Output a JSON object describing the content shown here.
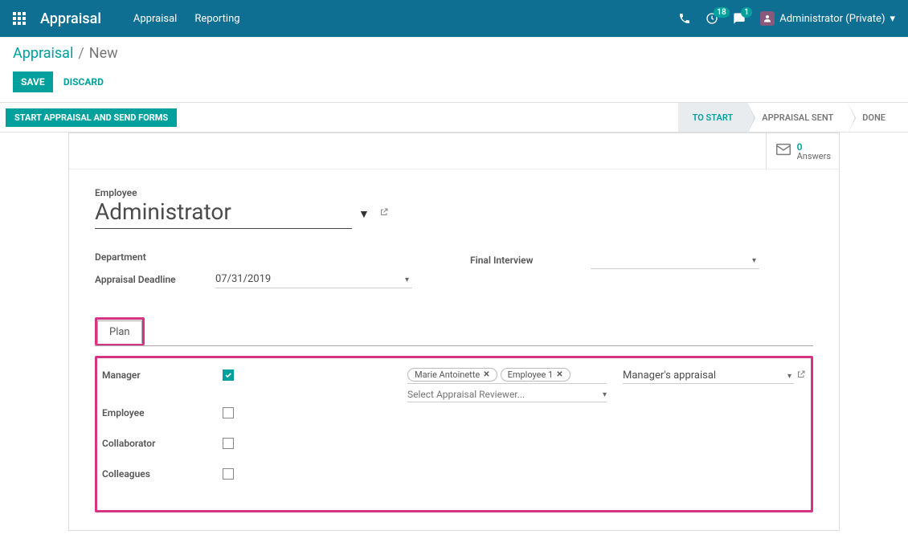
{
  "topnav": {
    "app_title": "Appraisal",
    "links": {
      "appraisal": "Appraisal",
      "reporting": "Reporting"
    },
    "badges": {
      "activity": "18",
      "messages": "1"
    },
    "user": "Administrator (Private)"
  },
  "breadcrumb": {
    "root": "Appraisal",
    "sep": "/",
    "current": "New"
  },
  "cp": {
    "save": "SAVE",
    "discard": "DISCARD"
  },
  "statusbar": {
    "start_btn": "START APPRAISAL AND SEND FORMS",
    "stage1": "TO START",
    "stage2": "APPRAISAL SENT",
    "stage3": "DONE"
  },
  "statbox": {
    "value": "0",
    "label": "Answers"
  },
  "form": {
    "employee_label": "Employee",
    "employee_value": "Administrator",
    "department_label": "Department",
    "deadline_label": "Appraisal Deadline",
    "deadline_value": "07/31/2019",
    "final_interview_label": "Final Interview"
  },
  "tabs": {
    "plan": "Plan"
  },
  "plan": {
    "rows": {
      "manager": "Manager",
      "employee": "Employee",
      "collaborator": "Collaborator",
      "colleagues": "Colleagues"
    },
    "tags": {
      "t1": "Marie Antoinette",
      "t2": "Employee 1"
    },
    "reviewer_placeholder": "Select Appraisal Reviewer...",
    "appraisal_value": "Manager's appraisal"
  }
}
